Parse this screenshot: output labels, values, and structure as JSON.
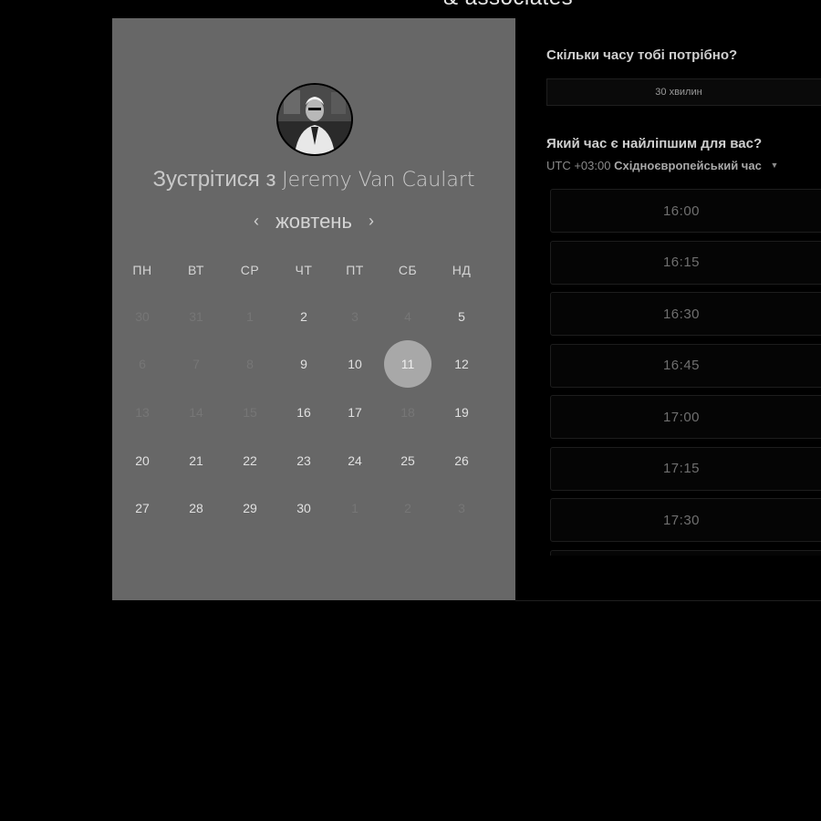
{
  "header": {
    "brand_fragment": "& associates"
  },
  "booking": {
    "title_prefix": "Зустрітися з",
    "host_name": "Jeremy Van Caulart",
    "month": "жовтень",
    "weekdays": [
      "ПН",
      "ВТ",
      "СР",
      "ЧТ",
      "ПТ",
      "СБ",
      "НД"
    ],
    "weeks": [
      [
        {
          "d": "30",
          "s": "inactive"
        },
        {
          "d": "31",
          "s": "inactive"
        },
        {
          "d": "1",
          "s": "inactive"
        },
        {
          "d": "2",
          "s": "available"
        },
        {
          "d": "3",
          "s": "inactive"
        },
        {
          "d": "4",
          "s": "inactive"
        },
        {
          "d": "5",
          "s": "available"
        }
      ],
      [
        {
          "d": "6",
          "s": "inactive"
        },
        {
          "d": "7",
          "s": "inactive"
        },
        {
          "d": "8",
          "s": "inactive"
        },
        {
          "d": "9",
          "s": "available"
        },
        {
          "d": "10",
          "s": "available"
        },
        {
          "d": "11",
          "s": "selected"
        },
        {
          "d": "12",
          "s": "available"
        }
      ],
      [
        {
          "d": "13",
          "s": "inactive"
        },
        {
          "d": "14",
          "s": "inactive"
        },
        {
          "d": "15",
          "s": "inactive"
        },
        {
          "d": "16",
          "s": "available"
        },
        {
          "d": "17",
          "s": "available"
        },
        {
          "d": "18",
          "s": "inactive"
        },
        {
          "d": "19",
          "s": "available"
        }
      ],
      [
        {
          "d": "20",
          "s": "available"
        },
        {
          "d": "21",
          "s": "available"
        },
        {
          "d": "22",
          "s": "available"
        },
        {
          "d": "23",
          "s": "available"
        },
        {
          "d": "24",
          "s": "available"
        },
        {
          "d": "25",
          "s": "available"
        },
        {
          "d": "26",
          "s": "available"
        }
      ],
      [
        {
          "d": "27",
          "s": "available"
        },
        {
          "d": "28",
          "s": "available"
        },
        {
          "d": "29",
          "s": "available"
        },
        {
          "d": "30",
          "s": "available"
        },
        {
          "d": "1",
          "s": "inactive"
        },
        {
          "d": "2",
          "s": "inactive"
        },
        {
          "d": "3",
          "s": "inactive"
        }
      ]
    ]
  },
  "duration": {
    "question": "Скільки часу тобі потрібно?",
    "selected": "30 хвилин"
  },
  "times": {
    "question": "Який час є найліпшим для вас?",
    "tz_offset": "UTC +03:00",
    "tz_name": "Східноєвропейський час",
    "slots": [
      "16:00",
      "16:15",
      "16:30",
      "16:45",
      "17:00",
      "17:15",
      "17:30"
    ]
  },
  "colors": {
    "page_bg": "#000000",
    "calendar_bg": "#676767",
    "selected_day": "#a8a8a8"
  }
}
